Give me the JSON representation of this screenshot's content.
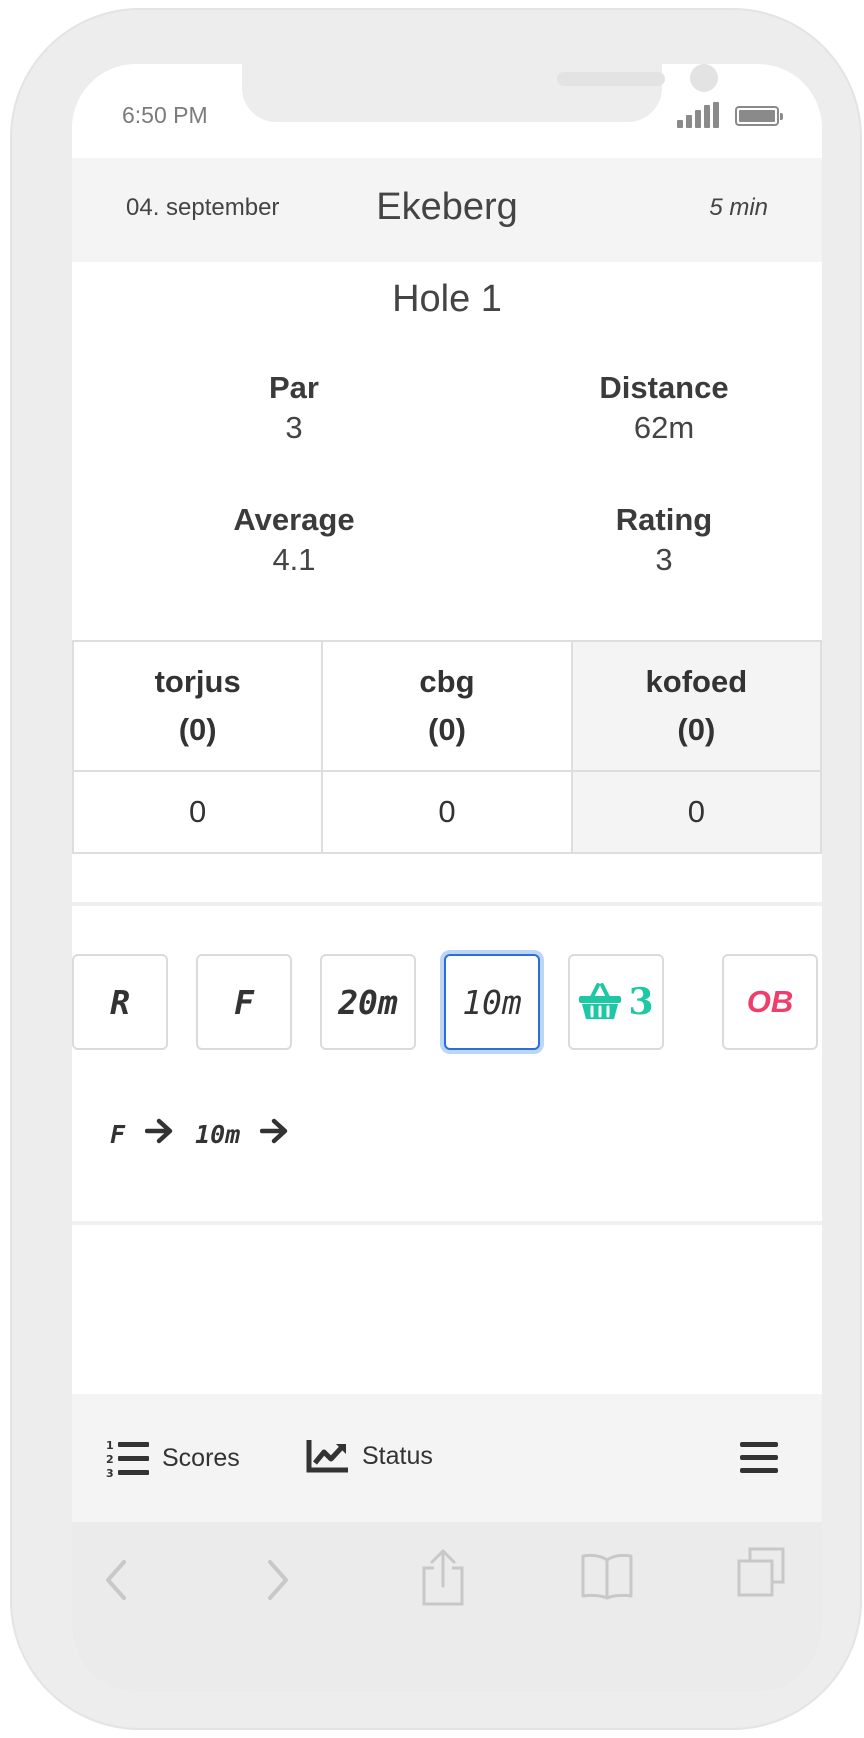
{
  "status_bar": {
    "time": "6:50 PM",
    "icons": [
      "signal-icon",
      "battery-icon"
    ]
  },
  "header": {
    "date": "04. september",
    "course": "Ekeberg",
    "duration": "5 min"
  },
  "hole": {
    "title": "Hole 1",
    "stats": [
      {
        "label": "Par",
        "value": "3"
      },
      {
        "label": "Distance",
        "value": "62m"
      },
      {
        "label": "Average",
        "value": "4.1"
      },
      {
        "label": "Rating",
        "value": "3"
      }
    ]
  },
  "players": [
    {
      "name": "torjus",
      "total": "(0)",
      "score": "0",
      "active": false
    },
    {
      "name": "cbg",
      "total": "(0)",
      "score": "0",
      "active": false
    },
    {
      "name": "kofoed",
      "total": "(0)",
      "score": "0",
      "active": true
    }
  ],
  "shot_buttons": [
    {
      "label": "R",
      "state": "normal"
    },
    {
      "label": "F",
      "state": "normal"
    },
    {
      "label": "20m",
      "state": "normal"
    },
    {
      "label": "10m",
      "state": "selected"
    },
    {
      "label": "3",
      "icon": "basket-icon",
      "state": "normal"
    },
    {
      "label": "OB",
      "state": "normal"
    }
  ],
  "shot_sequence": [
    "F",
    "10m"
  ],
  "bottom_nav": {
    "scores_label": "Scores",
    "status_label": "Status",
    "icons": [
      "numbered-list-icon",
      "chart-line-icon",
      "hamburger-menu-icon"
    ]
  },
  "browser_bar": {
    "icons": [
      "back-arrow-icon",
      "forward-arrow-icon",
      "share-icon",
      "bookmarks-icon",
      "tabs-icon"
    ]
  },
  "colors": {
    "accent_blue": "#2a6fd6",
    "basket_teal": "#1dc9a4",
    "ob_red": "#f03e6c",
    "bar_grey": "#f4f4f4",
    "text": "#333333"
  }
}
